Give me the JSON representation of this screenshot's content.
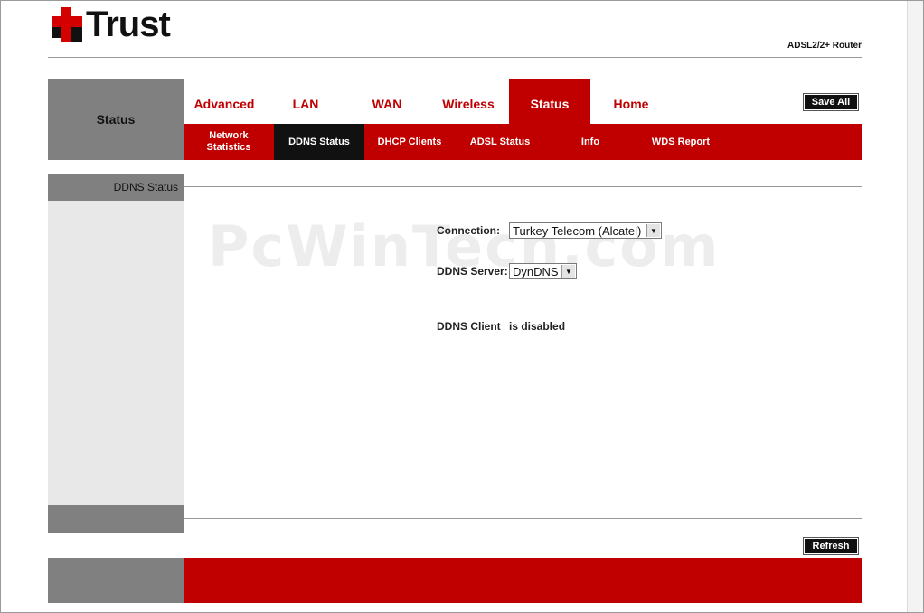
{
  "brand": {
    "logo_text": "Trust",
    "product": "ADSL2/2+ Router"
  },
  "header": {
    "section_title": "Status",
    "save_all_label": "Save All"
  },
  "tabs": [
    {
      "label": "Advanced"
    },
    {
      "label": "LAN"
    },
    {
      "label": "WAN"
    },
    {
      "label": "Wireless"
    },
    {
      "label": "Status"
    },
    {
      "label": "Home"
    }
  ],
  "subtabs": [
    {
      "line1": "Network",
      "line2": "Statistics"
    },
    {
      "line1": "DDNS Status",
      "line2": ""
    },
    {
      "line1": "DHCP Clients",
      "line2": ""
    },
    {
      "line1": "ADSL Status",
      "line2": ""
    },
    {
      "line1": "Info",
      "line2": ""
    },
    {
      "line1": "WDS Report",
      "line2": ""
    }
  ],
  "sidebar": {
    "title": "DDNS Status"
  },
  "form": {
    "connection_label": "Connection:",
    "connection_value": "Turkey Telecom (Alcatel)",
    "server_label": "DDNS Server:",
    "server_value": "DynDNS",
    "client_label": "DDNS Client",
    "client_status": "is disabled"
  },
  "actions": {
    "refresh_label": "Refresh"
  },
  "watermark": "PcWinTech.com",
  "colors": {
    "accent_red": "#c00000",
    "panel_gray": "#808080",
    "side_gray": "#e8e8e8"
  }
}
